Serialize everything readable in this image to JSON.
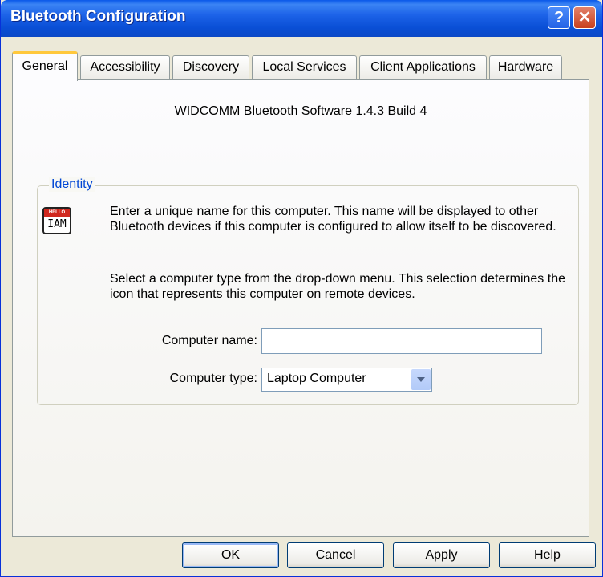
{
  "window": {
    "title": "Bluetooth Configuration",
    "help_glyph": "?",
    "close_glyph": "✕"
  },
  "tabs": [
    {
      "label": "General",
      "active": true
    },
    {
      "label": "Accessibility"
    },
    {
      "label": "Discovery"
    },
    {
      "label": "Local Services"
    },
    {
      "label": "Client Applications"
    },
    {
      "label": "Hardware"
    }
  ],
  "general": {
    "version_text": "WIDCOMM Bluetooth Software 1.4.3 Build 4",
    "identity": {
      "group_label": "Identity",
      "icon": {
        "name": "hello-i-am-icon",
        "top_text": "HELLO",
        "text": "IAM"
      },
      "description1": "Enter a unique name for this computer.  This name will be displayed to other Bluetooth devices if this computer is configured to allow itself to be discovered.",
      "description2": "Select a computer type from the drop-down menu.  This selection determines the icon that represents this computer on remote devices.",
      "computer_name_label": "Computer name:",
      "computer_name_value": "",
      "computer_type_label": "Computer type:",
      "computer_type_value": "Laptop Computer"
    }
  },
  "buttons": {
    "ok": "OK",
    "cancel": "Cancel",
    "apply": "Apply",
    "help": "Help"
  },
  "colors": {
    "title_bar": "#0A4FD6",
    "active_tab_accent": "#FFC83C",
    "group_label": "#0046D5"
  }
}
